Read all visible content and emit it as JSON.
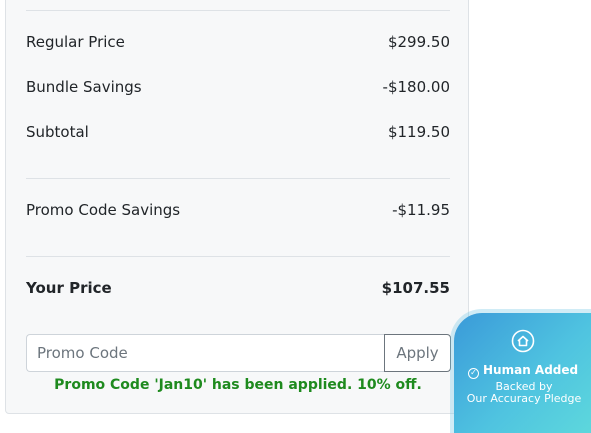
{
  "price_summary": {
    "regular_price": {
      "label": "Regular Price",
      "value": "$299.50"
    },
    "bundle_savings": {
      "label": "Bundle Savings",
      "value": "-$180.00"
    },
    "subtotal": {
      "label": "Subtotal",
      "value": "$119.50"
    },
    "promo_savings": {
      "label": "Promo Code Savings",
      "value": "-$11.95"
    },
    "your_price": {
      "label": "Your Price",
      "value": "$107.55"
    }
  },
  "promo": {
    "placeholder": "Promo Code",
    "apply_label": "Apply",
    "message": "Promo Code 'Jan10' has been applied. 10% off.",
    "message_color": "#1e8a1e"
  },
  "badge": {
    "icon": "house-icon",
    "title": "Human Added",
    "subtitle_line1": "Backed by",
    "subtitle_line2": "Our Accuracy Pledge"
  }
}
